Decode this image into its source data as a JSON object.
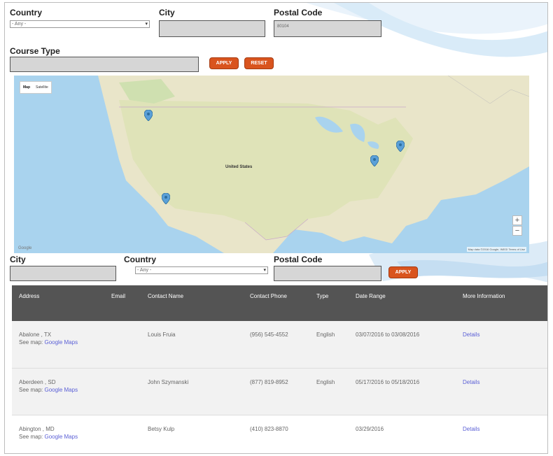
{
  "filters_top": {
    "country_label": "Country",
    "country_value": "- Any -",
    "city_label": "City",
    "postal_label": "Postal Code",
    "postal_value": "80104",
    "course_type_label": "Course Type",
    "apply_label": "APPLY",
    "reset_label": "RESET"
  },
  "map": {
    "map_tab": "Map",
    "satellite_tab": "Satellite",
    "zoom_in": "+",
    "zoom_out": "−",
    "attribution": "Map data ©2016 Google, INEGI  Terms of Use",
    "logo": "Google",
    "country_label": "United States",
    "water_color": "#a9d3ee",
    "land_color": "#e9e5c9"
  },
  "filters_bottom": {
    "city_label": "City",
    "country_label": "Country",
    "country_value": "- Any -",
    "postal_label": "Postal Code",
    "apply_label": "APPLY"
  },
  "table": {
    "headers": [
      "Address",
      "Email",
      "Contact Name",
      "Contact Phone",
      "Type",
      "Date Range",
      "More Information"
    ],
    "see_map_label": "See map:",
    "rows": [
      {
        "address": "Abalone , TX",
        "map_link": "Google Maps",
        "email": "",
        "contact": "Louis Fruia",
        "phone": "(956) 545-4552",
        "type": "English",
        "date": "03/07/2016 to 03/08/2016",
        "info": "Details"
      },
      {
        "address": "Aberdeen , SD",
        "map_link": "Google Maps",
        "email": "",
        "contact": "John Szymanski",
        "phone": "(877) 819-8952",
        "type": "English",
        "date": "05/17/2016 to 05/18/2016",
        "info": "Details"
      },
      {
        "address": "Abington , MD",
        "map_link": "Google Maps",
        "email": "",
        "contact": "Betsy Kulp",
        "phone": "(410) 823-8870",
        "type": "",
        "date": "03/29/2016",
        "info": "Details"
      }
    ]
  },
  "colors": {
    "accent_button": "#d9541e",
    "table_header": "#545454",
    "link": "#5a5fd6"
  }
}
